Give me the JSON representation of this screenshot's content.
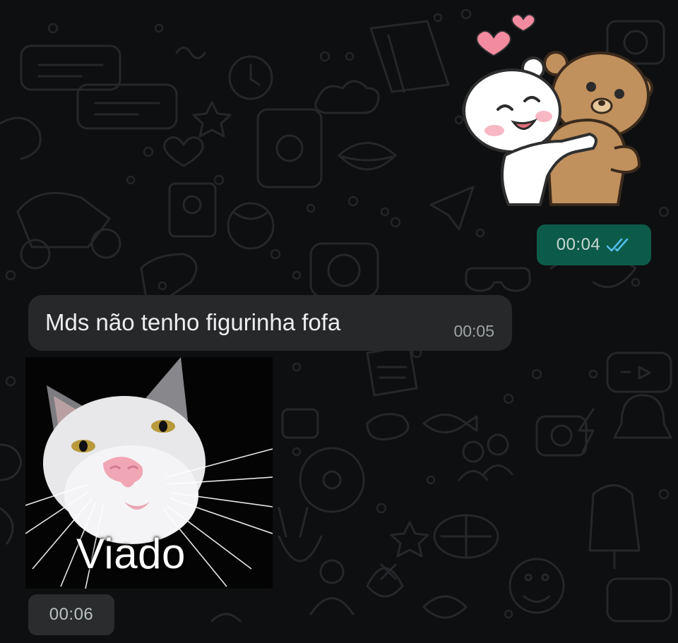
{
  "conversation": {
    "outgoing_sticker": {
      "icon": "hugging-bears-sticker-icon",
      "time": "00:04",
      "read_status_icon": "double-check-read-icon",
      "bubble_color": "#0c5b48",
      "tick_color": "#53bdeb"
    },
    "incoming_message": {
      "text": "Mds não tenho figurinha fofa",
      "time": "00:05",
      "bubble_color": "#27282a"
    },
    "incoming_sticker": {
      "icon": "white-cat-sticker-icon",
      "caption": "Viado",
      "time": "00:06"
    }
  },
  "theme": {
    "background": "#0e0f10",
    "doodle_color": "#2a2c2e"
  }
}
